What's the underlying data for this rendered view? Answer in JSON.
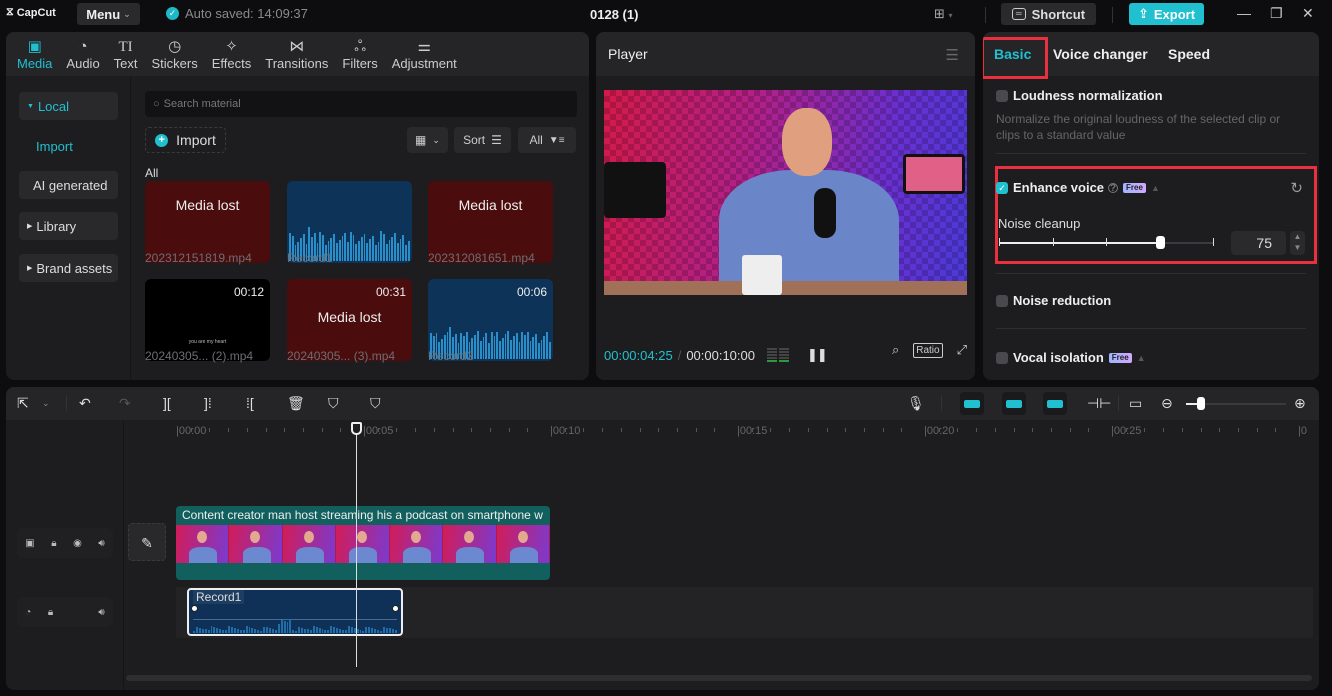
{
  "titlebar": {
    "app_name": "CapCut",
    "menu_label": "Menu",
    "autosave_text": "Auto saved: 14:09:37",
    "project_title": "0128 (1)",
    "shortcut_label": "Shortcut",
    "export_label": "Export",
    "accent_color": "#20c0d0"
  },
  "media_tabs": [
    {
      "label": "Media",
      "icon": "media-icon",
      "glyph": "▣",
      "active": true
    },
    {
      "label": "Audio",
      "icon": "audio-icon",
      "glyph": "◔"
    },
    {
      "label": "Text",
      "icon": "text-icon",
      "glyph": "TI"
    },
    {
      "label": "Stickers",
      "icon": "sticker-icon",
      "glyph": "◷"
    },
    {
      "label": "Effects",
      "icon": "effects-icon",
      "glyph": "✧"
    },
    {
      "label": "Transitions",
      "icon": "transitions-icon",
      "glyph": "⋈"
    },
    {
      "label": "Filters",
      "icon": "filters-icon",
      "glyph": "ஃ"
    },
    {
      "label": "Adjustment",
      "icon": "adjustment-icon",
      "glyph": "⚌"
    }
  ],
  "media_sidebar": {
    "local": "Local",
    "import": "Import",
    "ai_generated": "AI generated",
    "library": "Library",
    "brand_assets": "Brand assets"
  },
  "media_main": {
    "search_placeholder": "Search material",
    "import_label": "Import",
    "sort_label": "Sort",
    "filter_label": "All",
    "section_label": "All",
    "items": [
      {
        "type": "lost",
        "overlay": "Media lost",
        "duration": "",
        "caption": "202312151819.mp4"
      },
      {
        "type": "audio",
        "overlay": "",
        "duration": "",
        "caption": "Record1"
      },
      {
        "type": "lost",
        "overlay": "Media lost",
        "duration": "",
        "caption": "202312081651.mp4"
      },
      {
        "type": "black",
        "overlay": "you are my heart",
        "duration": "00:12",
        "caption": "20240305... (2).mp4"
      },
      {
        "type": "lost",
        "overlay": "Media lost",
        "duration": "00:31",
        "caption": "20240305... (3).mp4"
      },
      {
        "type": "audio",
        "overlay": "",
        "duration": "00:06",
        "caption": "Record2"
      }
    ]
  },
  "player": {
    "title": "Player",
    "current_time": "00:00:04:25",
    "total_time": "00:00:10:00",
    "ratio_label": "Ratio"
  },
  "right_panel": {
    "tabs": [
      {
        "label": "Basic",
        "active": true
      },
      {
        "label": "Voice changer"
      },
      {
        "label": "Speed"
      }
    ],
    "loudness": {
      "label": "Loudness normalization",
      "checked": false,
      "description": "Normalize the original loudness of the selected clip or clips to a standard value"
    },
    "enhance_voice": {
      "label": "Enhance voice",
      "checked": true,
      "badge": "Free",
      "noise_cleanup_label": "Noise cleanup",
      "noise_cleanup_value": "75",
      "noise_cleanup_fraction": 0.75
    },
    "noise_reduction": {
      "label": "Noise reduction",
      "checked": false
    },
    "vocal_isolation": {
      "label": "Vocal isolation",
      "checked": false,
      "badge": "Free"
    }
  },
  "timeline": {
    "ruler_labels": [
      "00:00",
      "00:05",
      "00:10",
      "00:15",
      "00:20",
      "00:25",
      "0"
    ],
    "playhead_time": "00:04:25",
    "zoom_fraction": 0.15,
    "video_clip_title": "Content creator man host streaming his a podcast on smartphone w",
    "audio_clip_title": "Record1"
  }
}
